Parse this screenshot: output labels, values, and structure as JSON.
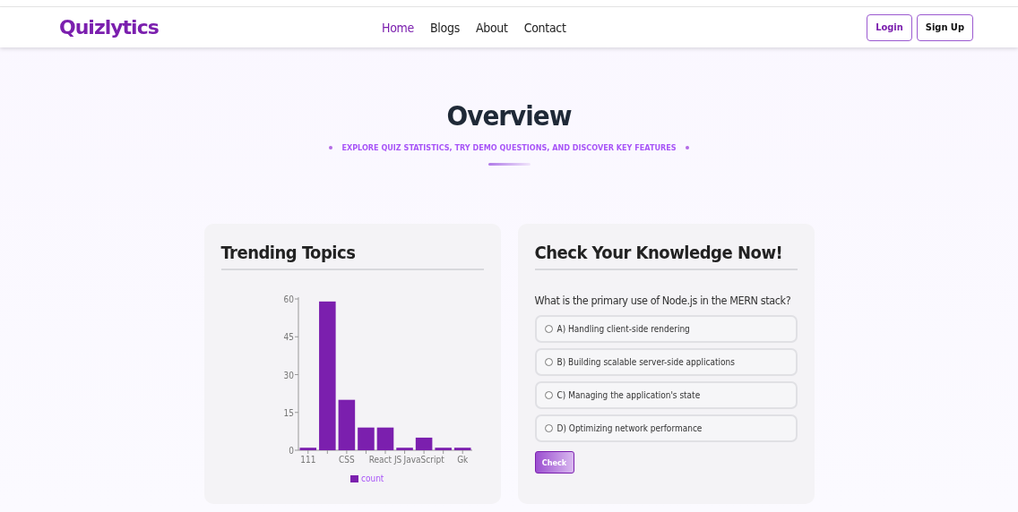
{
  "navbar": {
    "logo": "Quizlytics",
    "links": [
      {
        "label": "Home",
        "selected": true
      },
      {
        "label": "Blogs",
        "selected": false
      },
      {
        "label": "About",
        "selected": false
      },
      {
        "label": "Contact",
        "selected": false
      }
    ],
    "buttons": [
      {
        "label": "Login",
        "kind": "outline-accent"
      },
      {
        "label": "Sign Up",
        "kind": "outline"
      }
    ]
  },
  "overview": {
    "title": "Overview",
    "subtitle": "EXPLORE QUIZ STATISTICS, TRY DEMO QUESTIONS, AND DISCOVER KEY FEATURES"
  },
  "trending": {
    "title": "Trending Topics",
    "chart_data": {
      "type": "bar",
      "categories": [
        "111",
        null,
        "CSS",
        null,
        "React JS",
        null,
        "JavaScript",
        null,
        "Gk"
      ],
      "series": [
        {
          "name": "count",
          "color": "#7b1fae",
          "values": [
            1,
            59,
            20,
            9,
            9,
            1,
            5,
            1,
            1
          ]
        }
      ],
      "ylim": [
        0,
        60
      ],
      "yticks": [
        0,
        15,
        30,
        45,
        60
      ]
    }
  },
  "quiz": {
    "title": "Check Your Knowledge Now!",
    "question": "What is the primary use of Node.js in the MERN stack?",
    "options": [
      {
        "label": "A) Handling client-side rendering",
        "selected": false
      },
      {
        "label": "B) Building scalable server-side applications",
        "selected": false
      },
      {
        "label": "C) Managing the application's state",
        "selected": false
      },
      {
        "label": "D) Optimizing network performance",
        "selected": false
      }
    ],
    "button": "Check"
  }
}
